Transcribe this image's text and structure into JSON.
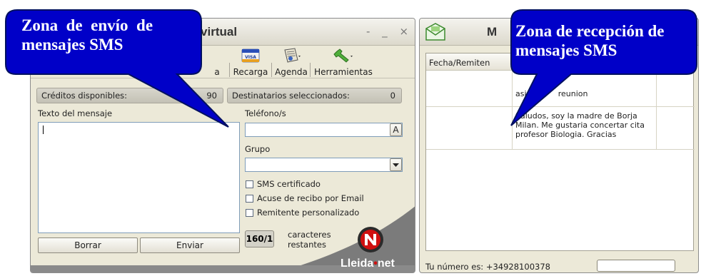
{
  "send_window": {
    "title": "S virtual",
    "window_controls": "- _ ×",
    "toolbar": [
      {
        "label": "a",
        "icon": "hidden-icon"
      },
      {
        "label": "Recarga",
        "icon": "visa-card-icon"
      },
      {
        "label": "Agenda",
        "icon": "address-book-icon"
      },
      {
        "label": "Herramientas",
        "icon": "wrench-icon"
      }
    ],
    "credits_label": "Créditos disponibles:",
    "credits_value": "90",
    "recipients_label": "Destinatarios seleccionados:",
    "recipients_value": "0",
    "message_label": "Texto del mensaje",
    "message_value": "",
    "phone_label": "Teléfono/s",
    "phone_value": "",
    "phone_button": "A",
    "group_label": "Grupo",
    "group_value": "",
    "options": [
      {
        "label": "SMS certificado",
        "checked": false
      },
      {
        "label": "Acuse de recibo por Email",
        "checked": false
      },
      {
        "label": "Remitente personalizado",
        "checked": false
      }
    ],
    "char_counter": "160/1",
    "char_counter_label_1": "caracteres",
    "char_counter_label_2": "restantes",
    "delete_button": "Borrar",
    "send_button": "Enviar",
    "brand": "Lleida",
    "brand_suffix": "net"
  },
  "receive_window": {
    "title": "M",
    "column_header": "Fecha/Remiten",
    "messages": [
      {
        "text": "asis           reunion"
      },
      {
        "text": "Saludos, soy la madre de Borja Milan. Me gustaria concertar cita profesor Biologia. Gracias"
      }
    ],
    "footer_label": "Tu número es: +34928100378",
    "footer_value": ""
  },
  "callouts": {
    "send_line1": "Zona  de  envío  de",
    "send_line2": "mensajes SMS",
    "receive_line1": "Zona de recepción de",
    "receive_line2": "mensajes SMS"
  },
  "colors": {
    "callout_fill": "#0000c8",
    "window_bg": "#ece9d8",
    "brand_red": "#d01010"
  }
}
